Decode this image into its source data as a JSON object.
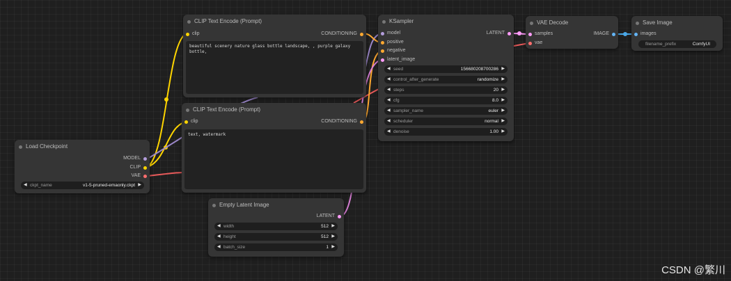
{
  "colors": {
    "model": "#b39ddb",
    "clip": "#ffd500",
    "vae": "#ff6e6e",
    "conditioning": "#ffa931",
    "latent": "#ff9cf9",
    "image": "#64b5f6"
  },
  "nodes": {
    "clip_pos": {
      "title": "CLIP Text Encode (Prompt)",
      "input": "clip",
      "output": "CONDITIONING",
      "text": "beautiful scenery nature glass bottle landscape, , purple galaxy bottle,"
    },
    "clip_neg": {
      "title": "CLIP Text Encode (Prompt)",
      "input": "clip",
      "output": "CONDITIONING",
      "text": "text, watermark"
    },
    "load_checkpoint": {
      "title": "Load Checkpoint",
      "outputs": [
        "MODEL",
        "CLIP",
        "VAE"
      ],
      "ckpt_label": "ckpt_name",
      "ckpt_value": "v1-5-pruned-emaonly.ckpt"
    },
    "empty_latent": {
      "title": "Empty Latent Image",
      "output": "LATENT",
      "widgets": [
        {
          "label": "width",
          "value": "512"
        },
        {
          "label": "height",
          "value": "512"
        },
        {
          "label": "batch_size",
          "value": "1"
        }
      ]
    },
    "ksampler": {
      "title": "KSampler",
      "inputs": [
        "model",
        "positive",
        "negative",
        "latent_image"
      ],
      "output": "LATENT",
      "widgets": [
        {
          "label": "seed",
          "value": "156680208700286"
        },
        {
          "label": "control_after_generate",
          "value": "randomize"
        },
        {
          "label": "steps",
          "value": "20"
        },
        {
          "label": "cfg",
          "value": "8.0"
        },
        {
          "label": "sampler_name",
          "value": "euler"
        },
        {
          "label": "scheduler",
          "value": "normal"
        },
        {
          "label": "denoise",
          "value": "1.00"
        }
      ]
    },
    "vae_decode": {
      "title": "VAE Decode",
      "inputs": [
        "samples",
        "vae"
      ],
      "output": "IMAGE"
    },
    "save_image": {
      "title": "Save Image",
      "input": "images",
      "widget": {
        "label": "filename_prefix",
        "value": "ComfyUI"
      }
    }
  },
  "watermark": "CSDN @繁川"
}
